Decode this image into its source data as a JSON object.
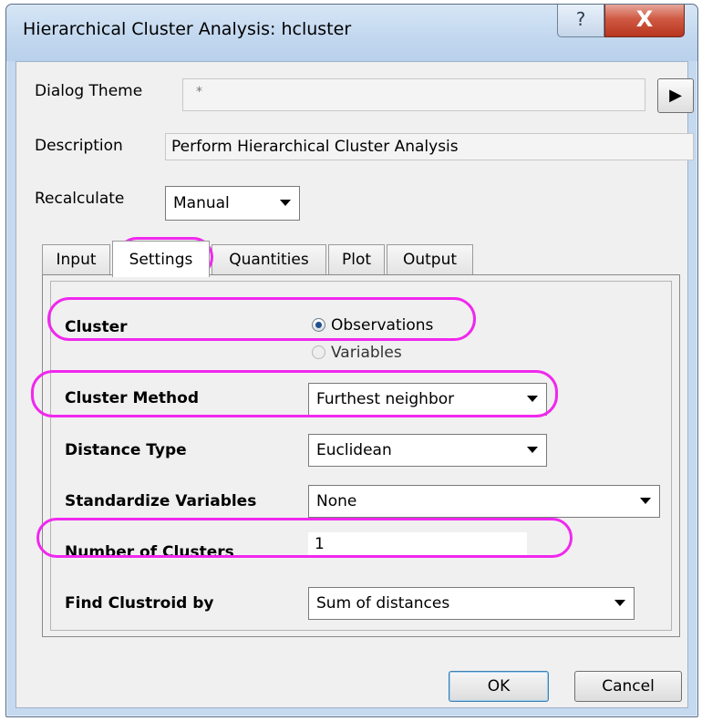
{
  "window": {
    "title": "Hierarchical Cluster Analysis: hcluster",
    "help_glyph": "?",
    "close_glyph": "X"
  },
  "header": {
    "dialog_theme_label": "Dialog Theme",
    "dialog_theme_value": "*",
    "theme_menu_glyph": "▶",
    "description_label": "Description",
    "description_value": "Perform Hierarchical Cluster Analysis",
    "recalculate_label": "Recalculate",
    "recalculate_value": "Manual"
  },
  "tabs": [
    {
      "label": "Input",
      "active": false
    },
    {
      "label": "Settings",
      "active": true
    },
    {
      "label": "Quantities",
      "active": false
    },
    {
      "label": "Plot",
      "active": false
    },
    {
      "label": "Output",
      "active": false
    }
  ],
  "settings": {
    "cluster_label": "Cluster",
    "cluster_options": [
      {
        "label": "Observations",
        "checked": true,
        "enabled": true
      },
      {
        "label": "Variables",
        "checked": false,
        "enabled": false
      }
    ],
    "cluster_method_label": "Cluster Method",
    "cluster_method_value": "Furthest neighbor",
    "distance_type_label": "Distance Type",
    "distance_type_value": "Euclidean",
    "standardize_label": "Standardize Variables",
    "standardize_value": "None",
    "num_clusters_label": "Number of Clusters",
    "num_clusters_value": "1",
    "clustroid_label": "Find Clustroid by",
    "clustroid_value": "Sum of distances"
  },
  "buttons": {
    "ok": "OK",
    "cancel": "Cancel"
  },
  "colors": {
    "annotation": "#f028ee",
    "close_button": "#c8462f",
    "titlebar": "#c3d8ef"
  }
}
